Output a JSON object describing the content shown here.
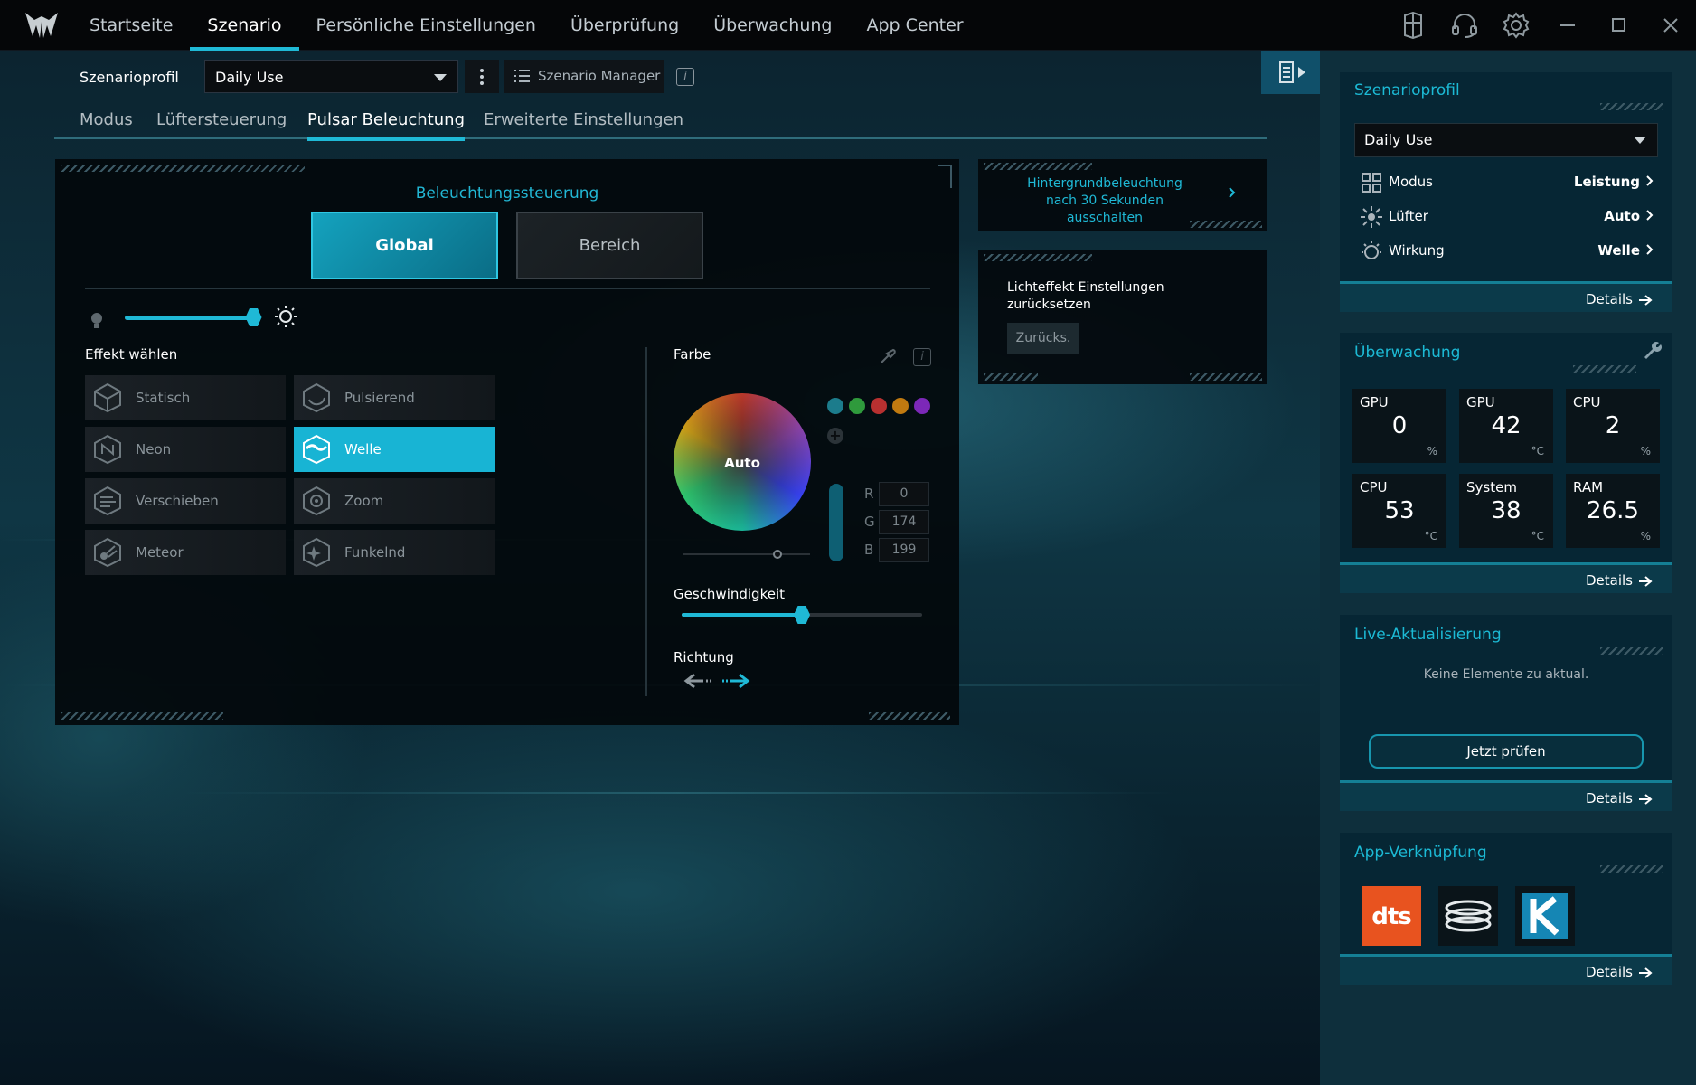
{
  "nav": {
    "items": [
      {
        "label": "Startseite",
        "active": false
      },
      {
        "label": "Szenario",
        "active": true
      },
      {
        "label": "Persönliche Einstellungen",
        "active": false
      },
      {
        "label": "Überprüfung",
        "active": false
      },
      {
        "label": "Überwachung",
        "active": false
      },
      {
        "label": "App Center",
        "active": false
      }
    ]
  },
  "profile": {
    "label": "Szenarioprofil",
    "selected": "Daily Use",
    "manager_label": "Szenario Manager",
    "info_glyph": "i"
  },
  "subtabs": [
    {
      "label": "Modus",
      "active": false
    },
    {
      "label": "Lüftersteuerung",
      "active": false
    },
    {
      "label": "Pulsar Beleuchtung",
      "active": true
    },
    {
      "label": "Erweiterte Einstellungen",
      "active": false
    }
  ],
  "lighting": {
    "control_title": "Beleuchtungssteuerung",
    "global_label": "Global",
    "bereich_label": "Bereich",
    "brightness_fraction": 0.95,
    "effect_title": "Effekt wählen",
    "effects": [
      {
        "label": "Statisch",
        "active": false
      },
      {
        "label": "Pulsierend",
        "active": false
      },
      {
        "label": "Neon",
        "active": false
      },
      {
        "label": "Welle",
        "active": true
      },
      {
        "label": "Verschieben",
        "active": false
      },
      {
        "label": "Zoom",
        "active": false
      },
      {
        "label": "Meteor",
        "active": false
      },
      {
        "label": "Funkelnd",
        "active": false
      }
    ],
    "color_title": "Farbe",
    "wheel_label": "Auto",
    "swatches": [
      "#1c7c8c",
      "#2f9a3c",
      "#b83030",
      "#c17a10",
      "#7c28b8"
    ],
    "rgb": {
      "r_label": "R",
      "g_label": "G",
      "b_label": "B",
      "r": "0",
      "g": "174",
      "b": "199"
    },
    "speed_title": "Geschwindigkeit",
    "speed_fraction": 0.5,
    "direction_title": "Richtung"
  },
  "side_cards": {
    "backlight_off": "Hintergrundbeleuchtung nach 30 Sekunden ausschalten",
    "reset_title": "Lichteffekt Einstellungen zurücksetzen",
    "reset_button": "Zurücks."
  },
  "sidebar": {
    "profile_card": {
      "title": "Szenarioprofil",
      "selected": "Daily Use",
      "rows": [
        {
          "key": "Modus",
          "value": "Leistung"
        },
        {
          "key": "Lüfter",
          "value": "Auto"
        },
        {
          "key": "Wirkung",
          "value": "Welle"
        }
      ],
      "details": "Details"
    },
    "monitor_card": {
      "title": "Überwachung",
      "tiles": [
        {
          "label": "GPU",
          "value": "0",
          "unit": "%"
        },
        {
          "label": "GPU",
          "value": "42",
          "unit": "°C"
        },
        {
          "label": "CPU",
          "value": "2",
          "unit": "%"
        },
        {
          "label": "CPU",
          "value": "53",
          "unit": "°C"
        },
        {
          "label": "System",
          "value": "38",
          "unit": "°C"
        },
        {
          "label": "RAM",
          "value": "26.5",
          "unit": "%"
        }
      ],
      "details": "Details"
    },
    "live_card": {
      "title": "Live-Aktualisierung",
      "empty_text": "Keine Elemente zu aktual.",
      "check_button": "Jetzt prüfen",
      "details": "Details"
    },
    "apps_card": {
      "title": "App-Verknüpfung",
      "apps": [
        "dts",
        "coil-app",
        "k-app"
      ],
      "details": "Details"
    }
  },
  "colors": {
    "accent": "#1fb9d6",
    "panel": "#03080c",
    "sidebar": "#0e2f3c"
  }
}
